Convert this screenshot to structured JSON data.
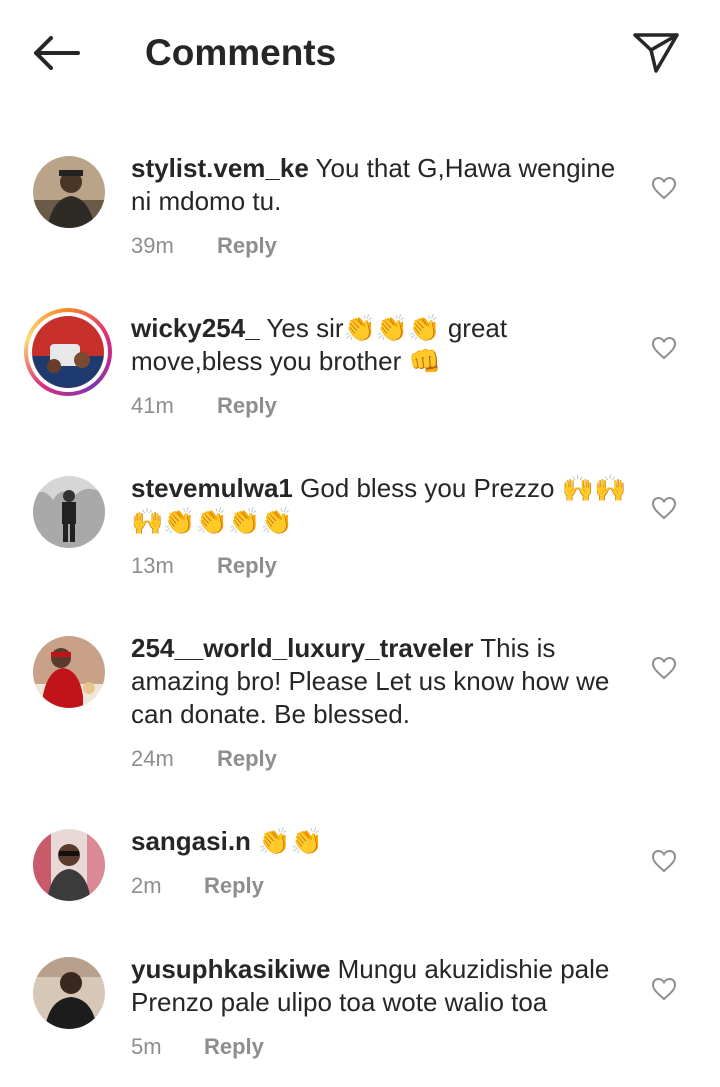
{
  "header": {
    "title": "Comments",
    "back_icon": "arrow-left-icon",
    "send_icon": "paper-plane-icon"
  },
  "comments": [
    {
      "username": "stylist.vem_ke",
      "text": " You that G,Hawa wengine ni mdomo tu.",
      "time": "39m",
      "reply": "Reply"
    },
    {
      "username": "wicky254_",
      "text": " Yes sir👏👏👏 great move,bless you brother 👊",
      "time": "41m",
      "reply": "Reply"
    },
    {
      "username": "stevemulwa1",
      "text": " God bless you Prezzo 🙌🙌🙌👏👏👏👏",
      "time": "13m",
      "reply": "Reply"
    },
    {
      "username": "254__world_luxury_traveler",
      "text": " This is amazing bro! Please Let us know how we can donate. Be blessed.",
      "time": "24m",
      "reply": "Reply"
    },
    {
      "username": "sangasi.n",
      "text": " 👏👏",
      "time": "2m",
      "reply": "Reply"
    },
    {
      "username": "yusuphkasikiwe",
      "text": " Mungu akuzidishie pale Prenzo pale ulipo toa wote walio toa",
      "time": "5m",
      "reply": "Reply"
    }
  ],
  "colors": {
    "text": "#262626",
    "secondary": "#8e8e8e",
    "story_ring": "#dd2a7b"
  }
}
